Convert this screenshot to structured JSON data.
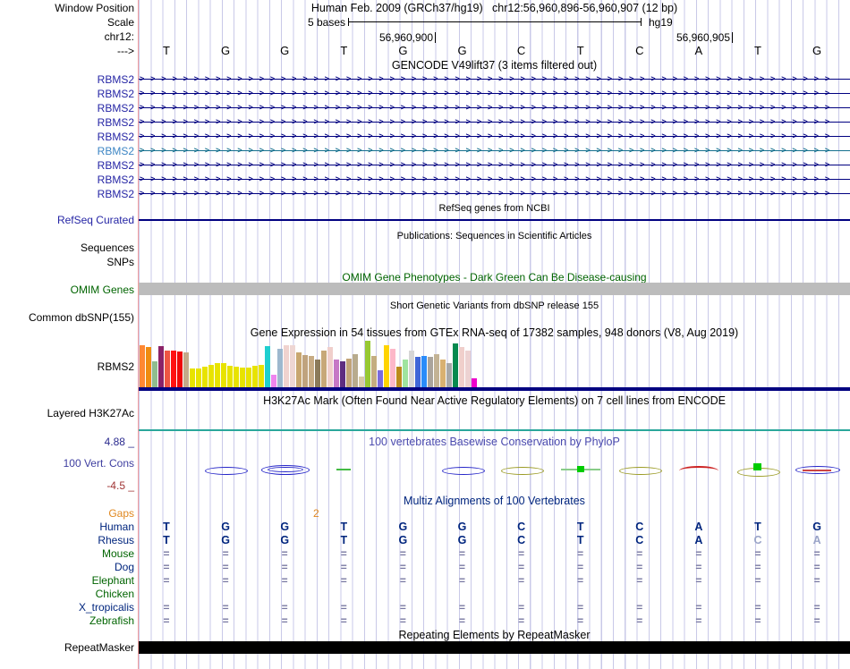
{
  "colors": {
    "navy": "#000080",
    "label_blue": "#2525a5",
    "light_label": "#3c85c4",
    "light_line": "#15708e",
    "green": "#006400",
    "orange": "#e08820",
    "slate": "#3e3ea0",
    "phylop_title": "#4a4aae",
    "maroon": "#a03434",
    "teal": "#2aa79b",
    "gray_bar": "#bcbcbc",
    "muted_base": "#9aa4c8",
    "letter_navy": "#00257e"
  },
  "header": {
    "row_label": "Window Position",
    "assembly_title": "Human Feb. 2009 (GRCh37/hg19)",
    "position": "chr12:56,960,896-56,960,907 (12 bp)",
    "scale_label": "Scale",
    "scale_value": "5 bases",
    "assembly_short": "hg19",
    "chrom_label": "chr12:",
    "coord_left": "56,960,900",
    "coord_right": "56,960,905",
    "strand_arrow": "--->"
  },
  "sequence": [
    "T",
    "G",
    "G",
    "T",
    "G",
    "G",
    "C",
    "T",
    "C",
    "A",
    "T",
    "G"
  ],
  "gencode": {
    "title": "GENCODE V49lift37 (3 items filtered out)",
    "transcripts": [
      {
        "label": "RBMS2",
        "style": "normal"
      },
      {
        "label": "RBMS2",
        "style": "normal"
      },
      {
        "label": "RBMS2",
        "style": "normal"
      },
      {
        "label": "RBMS2",
        "style": "normal"
      },
      {
        "label": "RBMS2",
        "style": "normal"
      },
      {
        "label": "RBMS2",
        "style": "light"
      },
      {
        "label": "RBMS2",
        "style": "normal"
      },
      {
        "label": "RBMS2",
        "style": "normal"
      },
      {
        "label": "RBMS2",
        "style": "normal"
      }
    ]
  },
  "refseq": {
    "title": "RefSeq genes from NCBI",
    "label": "RefSeq Curated"
  },
  "publications": {
    "title": "Publications: Sequences in Scientific Articles",
    "label_sequences": "Sequences",
    "label_snps": "SNPs"
  },
  "omim": {
    "title": "OMIM Gene Phenotypes - Dark Green Can Be Disease-causing",
    "label": "OMIM Genes"
  },
  "dbsnp": {
    "title": "Short Genetic Variants from dbSNP release 155",
    "label": "Common dbSNP(155)"
  },
  "gtex": {
    "title": "Gene Expression in 54 tissues from GTEx RNA-seq of 17382 samples, 948 donors (V8, Aug 2019)",
    "label": "RBMS2",
    "bars": [
      [
        "#ff8833",
        47
      ],
      [
        "#ef8c11",
        45
      ],
      [
        "#8fbc8f",
        29
      ],
      [
        "#8b2268",
        46
      ],
      [
        "#ee5544",
        41
      ],
      [
        "#ff1111",
        41
      ],
      [
        "#ee0808",
        40
      ],
      [
        "#c3a989",
        39
      ],
      [
        "#e8e300",
        21
      ],
      [
        "#e8e300",
        21
      ],
      [
        "#e8e300",
        23
      ],
      [
        "#e8e300",
        25
      ],
      [
        "#e8e300",
        27
      ],
      [
        "#e8e300",
        27
      ],
      [
        "#e8e300",
        24
      ],
      [
        "#e8e300",
        23
      ],
      [
        "#e8e300",
        22
      ],
      [
        "#e8e300",
        22
      ],
      [
        "#e8e300",
        24
      ],
      [
        "#e8e300",
        25
      ],
      [
        "#1fcfcf",
        46
      ],
      [
        "#ee85ee",
        14
      ],
      [
        "#9db8ce",
        43
      ],
      [
        "#f0d3cf",
        47
      ],
      [
        "#eed6d3",
        47
      ],
      [
        "#c8a670",
        39
      ],
      [
        "#bfa37e",
        36
      ],
      [
        "#c7ab84",
        35
      ],
      [
        "#8b7a5a",
        31
      ],
      [
        "#c7a878",
        41
      ],
      [
        "#f0cfcb",
        45
      ],
      [
        "#c678c6",
        31
      ],
      [
        "#5e2d80",
        29
      ],
      [
        "#c2a478",
        32
      ],
      [
        "#b8ab8d",
        37
      ],
      [
        "#d8cba6",
        12
      ],
      [
        "#97c832",
        52
      ],
      [
        "#c4ad80",
        35
      ],
      [
        "#7a6bdd",
        19
      ],
      [
        "#ffd400",
        47
      ],
      [
        "#fdb8c8",
        43
      ],
      [
        "#bb8a1c",
        23
      ],
      [
        "#9fe49f",
        31
      ],
      [
        "#d6d6d6",
        41
      ],
      [
        "#3f66d8",
        34
      ],
      [
        "#2a8cfa",
        35
      ],
      [
        "#aaa49c",
        34
      ],
      [
        "#c3b395",
        37
      ],
      [
        "#d9b171",
        31
      ],
      [
        "#a8a8a8",
        27
      ],
      [
        "#068a4f",
        49
      ],
      [
        "#f0cfcb",
        45
      ],
      [
        "#edd2d2",
        41
      ],
      [
        "#ee00cc",
        10
      ]
    ]
  },
  "h3k27ac": {
    "title": "H3K27Ac Mark (Often Found Near Active Regulatory Elements) on 7 cell lines from ENCODE",
    "label": "Layered H3K27Ac"
  },
  "phylop": {
    "title": "100 vertebrates Basewise Conservation by PhyloP",
    "label": "100 Vert. Cons",
    "max_label": "4.88 _",
    "min_label": "-4.5 _",
    "glyphs": [
      {
        "col": 1,
        "kind": "lens",
        "color": "#2525c8"
      },
      {
        "col": 2,
        "kind": "lens2",
        "color": "#2525c8"
      },
      {
        "col": 3,
        "kind": "dash",
        "color": "#44bb44"
      },
      {
        "col": 5,
        "kind": "lens",
        "color": "#2525c8"
      },
      {
        "col": 6,
        "kind": "lens",
        "color": "#9a9a22"
      },
      {
        "col": 7,
        "kind": "dash-sq",
        "color": "#88cc88",
        "sq": "#00cc00"
      },
      {
        "col": 8,
        "kind": "lens",
        "color": "#9a9a22"
      },
      {
        "col": 9,
        "kind": "arc",
        "color": "#cc2222"
      },
      {
        "col": 10,
        "kind": "lens-sq",
        "color": "#9a9a22",
        "sq": "#00cc00"
      },
      {
        "col": 11,
        "kind": "lens-red",
        "color": "#2525c8",
        "color2": "#cc4444"
      }
    ]
  },
  "multiz": {
    "title": "Multiz Alignments of 100 Vertebrates",
    "gaps_label": "Gaps",
    "gap_annotation": {
      "text": "2",
      "col": 3
    },
    "rows": [
      {
        "label": "Human",
        "label_color": "#00257e",
        "type": "letters",
        "cells": [
          "T",
          "G",
          "G",
          "T",
          "G",
          "G",
          "C",
          "T",
          "C",
          "A",
          "T",
          "G"
        ],
        "muted": []
      },
      {
        "label": "Rhesus",
        "label_color": "#00257e",
        "type": "letters",
        "cells": [
          "T",
          "G",
          "G",
          "T",
          "G",
          "G",
          "C",
          "T",
          "C",
          "A",
          "C",
          "A"
        ],
        "muted": [
          10,
          11
        ]
      },
      {
        "label": "Mouse",
        "label_color": "#006400",
        "type": "marks",
        "cells": [
          "=",
          "=",
          "=",
          "=",
          "=",
          "=",
          "=",
          "=",
          "=",
          "=",
          "=",
          "="
        ],
        "muted": []
      },
      {
        "label": "Dog",
        "label_color": "#00257e",
        "type": "marks",
        "cells": [
          "=",
          "=",
          "=",
          "=",
          "=",
          "=",
          "=",
          "=",
          "=",
          "=",
          "=",
          "="
        ],
        "muted": []
      },
      {
        "label": "Elephant",
        "label_color": "#006400",
        "type": "marks",
        "cells": [
          "=",
          "=",
          "=",
          "=",
          "=",
          "=",
          "=",
          "=",
          "=",
          "=",
          "=",
          "="
        ],
        "muted": []
      },
      {
        "label": "Chicken",
        "label_color": "#006400",
        "type": "marks",
        "cells": [
          "",
          "",
          "",
          "",
          "",
          "",
          "",
          "",
          "",
          "",
          "",
          ""
        ],
        "muted": []
      },
      {
        "label": "X_tropicalis",
        "label_color": "#00257e",
        "type": "marks",
        "cells": [
          "=",
          "=",
          "=",
          "=",
          "=",
          "=",
          "=",
          "=",
          "=",
          "=",
          "=",
          "="
        ],
        "muted": []
      },
      {
        "label": "Zebrafish",
        "label_color": "#006400",
        "type": "marks",
        "cells": [
          "=",
          "=",
          "=",
          "=",
          "=",
          "=",
          "=",
          "=",
          "=",
          "=",
          "=",
          "="
        ],
        "muted": []
      }
    ]
  },
  "repeatmasker": {
    "title": "Repeating Elements by RepeatMasker",
    "label": "RepeatMasker"
  }
}
